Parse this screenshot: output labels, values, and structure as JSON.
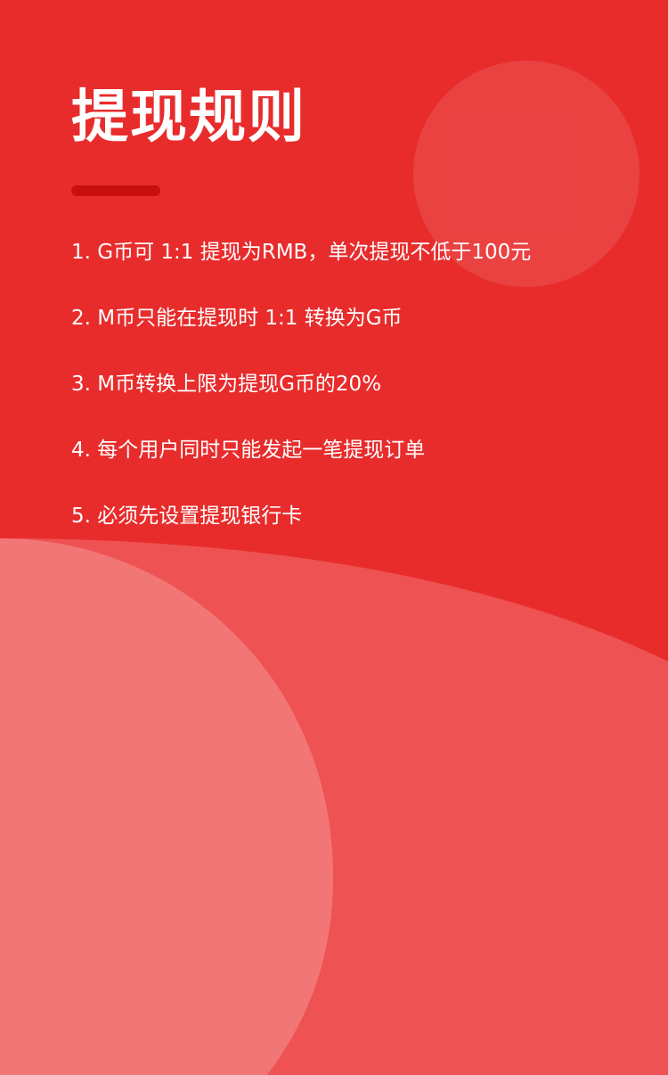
{
  "page": {
    "title": "提现规则"
  },
  "rules": [
    "1. G币可 1:1 提现为RMB，单次提现不低于100元",
    "2. M币只能在提现时 1:1 转换为G币",
    "3. M币转换上限为提现G币的20%",
    "4. 每个用户同时只能发起一笔提现订单",
    "5. 必须先设置提现银行卡"
  ],
  "colors": {
    "background": "#e82c2c",
    "underline": "#c8100f",
    "wave_light": "#ef5252",
    "circle_light": "#f27676",
    "text": "#ffffff"
  }
}
